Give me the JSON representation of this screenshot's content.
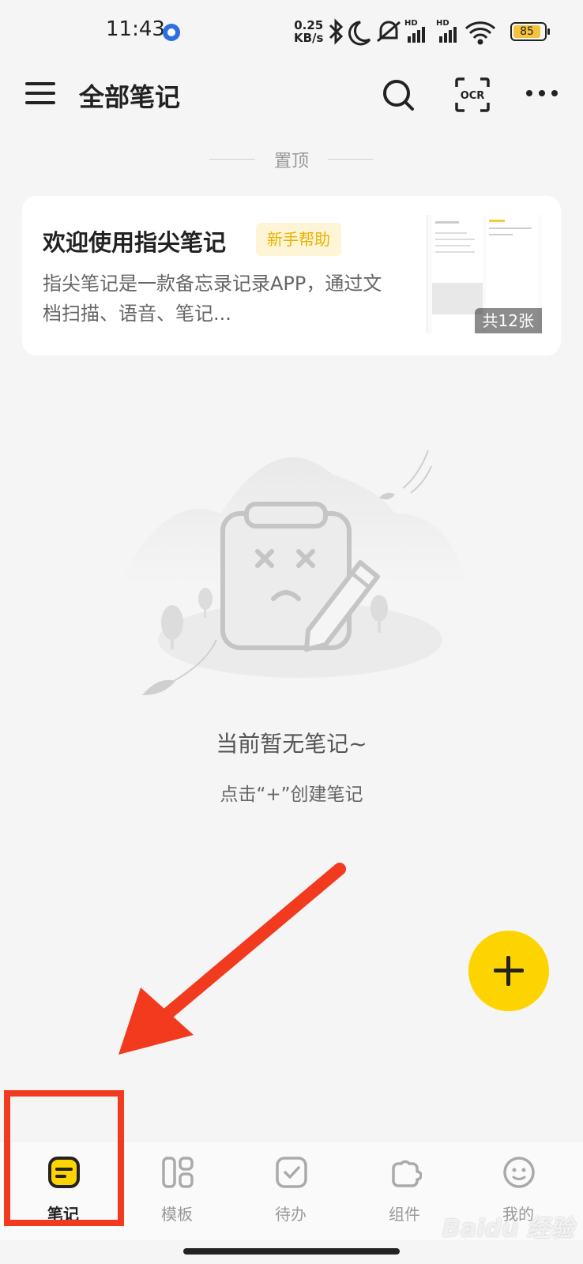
{
  "status_bar": {
    "time": "11:43",
    "speed_value": "0.25",
    "speed_unit": "KB/s",
    "battery": "85"
  },
  "header": {
    "title": "全部笔记",
    "ocr_label": "OCR"
  },
  "pinned": {
    "label": "置顶",
    "card": {
      "title": "欢迎使用指尖笔记",
      "tag": "新手帮助",
      "body": "指尖笔记是一款备忘录记录APP，通过文档扫描、语音、笔记...",
      "image_count": "共12张"
    }
  },
  "empty_state": {
    "title": "当前暂无笔记~",
    "hint": "点击“+”创建笔记"
  },
  "bottom_nav": {
    "items": [
      {
        "label": "笔记",
        "icon": "note-icon",
        "active": true
      },
      {
        "label": "模板",
        "icon": "template-icon",
        "active": false
      },
      {
        "label": "待办",
        "icon": "todo-icon",
        "active": false
      },
      {
        "label": "组件",
        "icon": "widget-icon",
        "active": false
      },
      {
        "label": "我的",
        "icon": "profile-icon",
        "active": false
      }
    ]
  },
  "colors": {
    "accent": "#fed400",
    "annotation": "#f23a1f",
    "background": "#f5f5f5"
  },
  "watermark": "Baidu 经验"
}
